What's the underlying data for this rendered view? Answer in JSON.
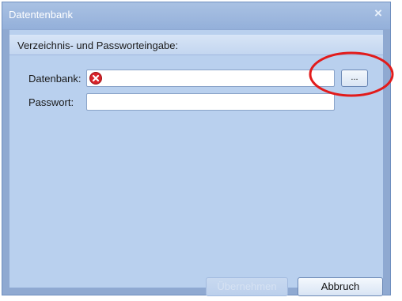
{
  "window": {
    "title": "Datentenbank",
    "close_symbol": "×"
  },
  "group": {
    "header": "Verzeichnis- und Passworteingabe:"
  },
  "fields": {
    "database_label": "Datenbank:",
    "database_value": "",
    "database_status_icon": "error-icon",
    "password_label": "Passwort:",
    "password_value": "",
    "browse_label": "..."
  },
  "buttons": {
    "apply_label": "Übernehmen",
    "cancel_label": "Abbruch"
  },
  "colors": {
    "error": "#d8232a",
    "annotation": "#e21b1b"
  }
}
